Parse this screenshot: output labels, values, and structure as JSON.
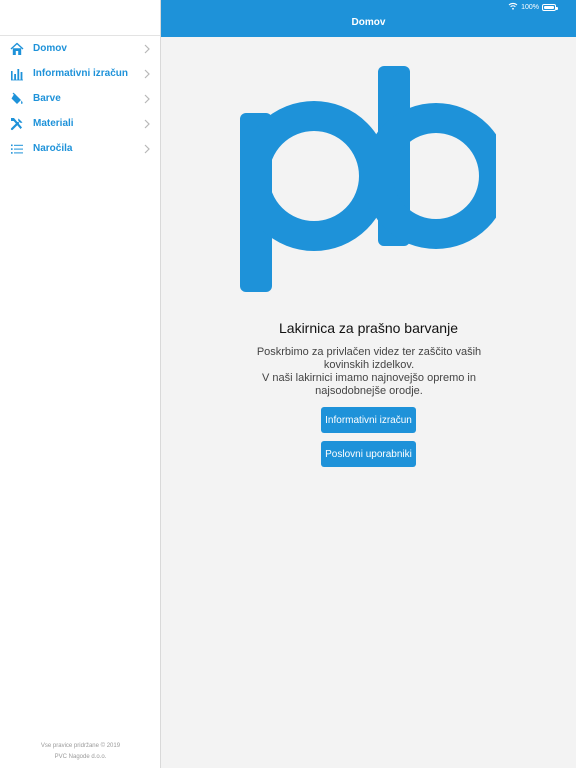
{
  "status_bar": {
    "battery": "100%"
  },
  "header": {
    "title": "Domov"
  },
  "sidebar": {
    "items": [
      {
        "label": "Domov",
        "icon": "home-icon"
      },
      {
        "label": "Informativni izračun",
        "icon": "bar-chart-icon"
      },
      {
        "label": "Barve",
        "icon": "paint-bucket-icon"
      },
      {
        "label": "Materiali",
        "icon": "tools-icon"
      },
      {
        "label": "Naročila",
        "icon": "list-icon"
      }
    ],
    "footer": {
      "copyright": "Vse pravice pridržane © 2019",
      "company": "PVC Nagode d.o.o."
    }
  },
  "main": {
    "logo_text": "pb",
    "headline": "Lakirnica za prašno barvanje",
    "description": {
      "line1": "Poskrbimo za privlačen videz ter zaščito vaših",
      "line2": "kovinskih izdelkov.",
      "line3": "V naši lakirnici imamo najnovejšo opremo in",
      "line4": "najsodobnejše orodje."
    },
    "buttons": {
      "calculation": "Informativni izračun",
      "business_users": "Poslovni uporabniki"
    }
  },
  "colors": {
    "accent": "#1e92d9",
    "background": "#f3f3f3",
    "sidebar": "#ffffff"
  }
}
